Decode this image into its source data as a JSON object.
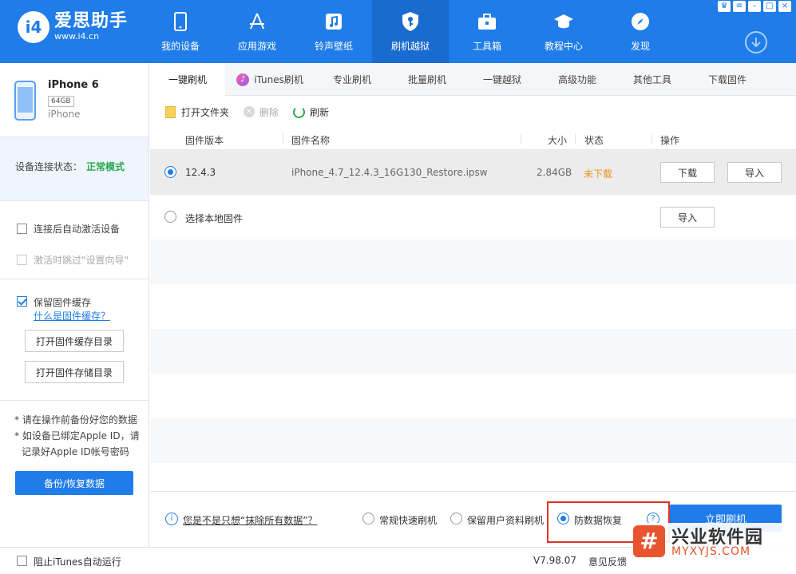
{
  "app": {
    "name": "爱思助手",
    "url": "www.i4.cn",
    "logo_mark": "i4"
  },
  "nav": [
    {
      "label": "我的设备",
      "icon": "phone-icon"
    },
    {
      "label": "应用游戏",
      "icon": "app-store-icon"
    },
    {
      "label": "铃声壁纸",
      "icon": "music-icon"
    },
    {
      "label": "刷机越狱",
      "icon": "shield-key-icon",
      "active": true
    },
    {
      "label": "工具箱",
      "icon": "toolbox-icon"
    },
    {
      "label": "教程中心",
      "icon": "graduation-cap-icon"
    },
    {
      "label": "发现",
      "icon": "compass-icon"
    }
  ],
  "device": {
    "name": "iPhone 6",
    "capacity": "64GB",
    "type": "iPhone",
    "conn_label": "设备连接状态：",
    "conn_value": "正常模式"
  },
  "sidebar": {
    "auto_activate": "连接后自动激活设备",
    "skip_setup": "激活时跳过\"设置向导\"",
    "keep_cache": "保留固件缓存",
    "what_is_cache": "什么是固件缓存？",
    "open_cache_dir": "打开固件缓存目录",
    "open_storage_dir": "打开固件存储目录",
    "note1": "* 请在操作前备份好您的数据",
    "note2": "* 如设备已绑定Apple ID，请",
    "note3": "记录好Apple ID帐号密码",
    "backup_btn": "备份/恢复数据"
  },
  "tabs": [
    {
      "label": "一键刷机",
      "active": true
    },
    {
      "label": "iTunes刷机"
    },
    {
      "label": "专业刷机"
    },
    {
      "label": "批量刷机"
    },
    {
      "label": "一键越狱"
    },
    {
      "label": "高级功能"
    },
    {
      "label": "其他工具"
    },
    {
      "label": "下载固件"
    }
  ],
  "toolbar": {
    "open_folder": "打开文件夹",
    "delete": "删除",
    "refresh": "刷新"
  },
  "table": {
    "headers": {
      "version": "固件版本",
      "name": "固件名称",
      "size": "大小",
      "status": "状态",
      "action": "操作"
    },
    "rows": [
      {
        "version": "12.4.3",
        "name": "iPhone_4.7_12.4.3_16G130_Restore.ipsw",
        "size": "2.84GB",
        "status": "未下载",
        "download": "下载",
        "import": "导入"
      }
    ],
    "local": {
      "label": "选择本地固件",
      "import": "导入"
    }
  },
  "options": {
    "question": "您是不是只想“抹除所有数据”？",
    "modes": [
      "常规快速刷机",
      "保留用户资料刷机",
      "防数据恢复"
    ],
    "selected_mode": "防数据恢复",
    "flash_btn": "立即刷机"
  },
  "status": {
    "block_itunes": "阻止iTunes自动运行",
    "version": "V7.98.07",
    "feedback": "意见反馈"
  },
  "watermark": {
    "title": "兴业软件园",
    "url": "MYXYJS.COM"
  },
  "colors": {
    "brand_blue": "#1f7ce8",
    "ok_green": "#2aa94f",
    "warn_orange": "#e8941a",
    "highlight_red": "#e0302a"
  }
}
